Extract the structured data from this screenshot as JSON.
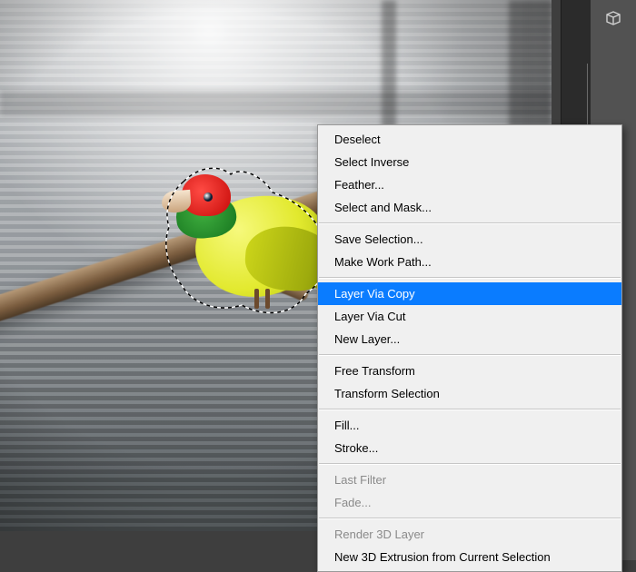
{
  "right_panel": {
    "tool_name": "3d-panel-icon"
  },
  "context_menu": {
    "groups": [
      {
        "items": [
          {
            "label": "Deselect",
            "state": "enabled"
          },
          {
            "label": "Select Inverse",
            "state": "enabled"
          },
          {
            "label": "Feather...",
            "state": "enabled"
          },
          {
            "label": "Select and Mask...",
            "state": "enabled"
          }
        ]
      },
      {
        "items": [
          {
            "label": "Save Selection...",
            "state": "enabled"
          },
          {
            "label": "Make Work Path...",
            "state": "enabled"
          }
        ]
      },
      {
        "items": [
          {
            "label": "Layer Via Copy",
            "state": "highlight"
          },
          {
            "label": "Layer Via Cut",
            "state": "enabled"
          },
          {
            "label": "New Layer...",
            "state": "enabled"
          }
        ]
      },
      {
        "items": [
          {
            "label": "Free Transform",
            "state": "enabled"
          },
          {
            "label": "Transform Selection",
            "state": "enabled"
          }
        ]
      },
      {
        "items": [
          {
            "label": "Fill...",
            "state": "enabled"
          },
          {
            "label": "Stroke...",
            "state": "enabled"
          }
        ]
      },
      {
        "items": [
          {
            "label": "Last Filter",
            "state": "disabled"
          },
          {
            "label": "Fade...",
            "state": "disabled"
          }
        ]
      },
      {
        "items": [
          {
            "label": "Render 3D Layer",
            "state": "disabled"
          },
          {
            "label": "New 3D Extrusion from Current Selection",
            "state": "enabled"
          }
        ]
      }
    ]
  }
}
